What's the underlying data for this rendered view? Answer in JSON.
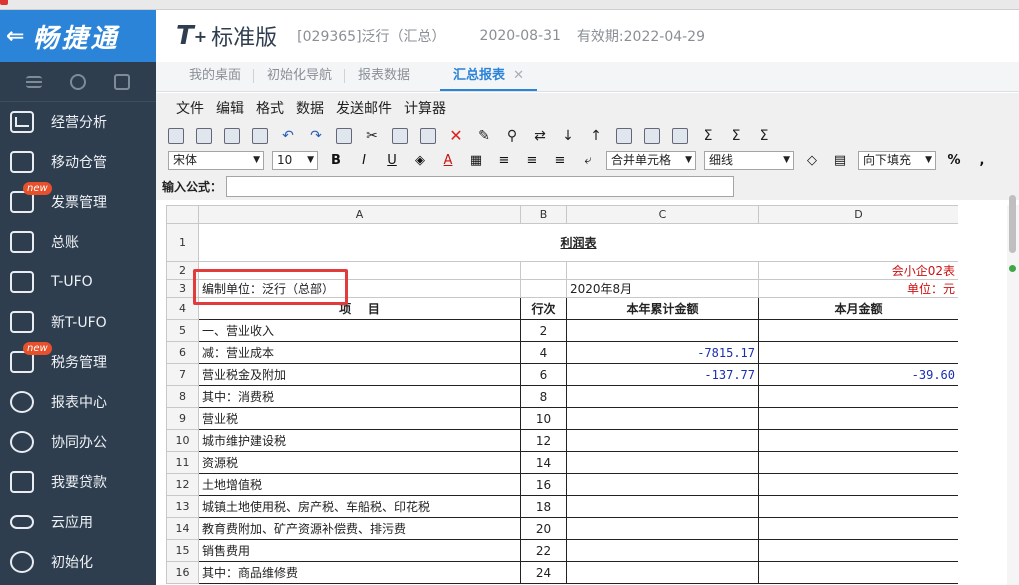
{
  "sidebar": {
    "brand": "畅捷通",
    "items": [
      {
        "label": "经营分析",
        "badge": ""
      },
      {
        "label": "移动仓管",
        "badge": ""
      },
      {
        "label": "发票管理",
        "badge": "new"
      },
      {
        "label": "总账",
        "badge": ""
      },
      {
        "label": "T-UFO",
        "badge": ""
      },
      {
        "label": "新T-UFO",
        "badge": ""
      },
      {
        "label": "税务管理",
        "badge": "new"
      },
      {
        "label": "报表中心",
        "badge": ""
      },
      {
        "label": "协同办公",
        "badge": ""
      },
      {
        "label": "我要贷款",
        "badge": ""
      },
      {
        "label": "云应用",
        "badge": ""
      },
      {
        "label": "初始化",
        "badge": ""
      }
    ]
  },
  "header": {
    "logo_t": "T",
    "logo_plus": "+",
    "edition": "标准版",
    "account": "[029365]泛行（汇总）",
    "date": "2020-08-31",
    "expiry": "有效期:2022-04-29"
  },
  "tabs": [
    {
      "label": "我的桌面"
    },
    {
      "label": "初始化导航"
    },
    {
      "label": "报表数据"
    },
    {
      "label": "汇总报表",
      "close": "✕"
    }
  ],
  "menu": [
    "文件",
    "编辑",
    "格式",
    "数据",
    "发送邮件",
    "计算器"
  ],
  "toolbar": {
    "font": "宋体",
    "size": "10",
    "bold": "B",
    "italic": "I",
    "underline": "U",
    "merge": "合并单元格",
    "border": "细线",
    "fill": "向下填充",
    "percent": "%",
    "comma": ","
  },
  "formula": {
    "label": "输入公式：",
    "value": ""
  },
  "sheet": {
    "columns": [
      "A",
      "B",
      "C",
      "D"
    ],
    "title": "利润表",
    "form_code": "会小企02表",
    "unit_label": "编制单位：泛行（总部）",
    "period": "2020年8月",
    "currency": "单位：元",
    "headers": [
      "项    目",
      "行次",
      "本年累计金额",
      "本月金额"
    ],
    "rows": [
      {
        "num": "5",
        "item": "一、营业收入",
        "line": "2",
        "ytd": "",
        "month": ""
      },
      {
        "num": "6",
        "item": "减：营业成本",
        "line": "4",
        "ytd": "-7815.17",
        "month": ""
      },
      {
        "num": "7",
        "item": "营业税金及附加",
        "line": "6",
        "ytd": "-137.77",
        "month": "-39.60"
      },
      {
        "num": "8",
        "item": "其中：消费税",
        "line": "8",
        "ytd": "",
        "month": ""
      },
      {
        "num": "9",
        "item": "营业税",
        "line": "10",
        "ytd": "",
        "month": ""
      },
      {
        "num": "10",
        "item": "城市维护建设税",
        "line": "12",
        "ytd": "",
        "month": ""
      },
      {
        "num": "11",
        "item": "资源税",
        "line": "14",
        "ytd": "",
        "month": ""
      },
      {
        "num": "12",
        "item": "土地增值税",
        "line": "16",
        "ytd": "",
        "month": ""
      },
      {
        "num": "13",
        "item": "城镇土地使用税、房产税、车船税、印花税",
        "line": "18",
        "ytd": "",
        "month": ""
      },
      {
        "num": "14",
        "item": "教育费附加、矿产资源补偿费、排污费",
        "line": "20",
        "ytd": "",
        "month": ""
      },
      {
        "num": "15",
        "item": "销售费用",
        "line": "22",
        "ytd": "",
        "month": ""
      },
      {
        "num": "16",
        "item": "其中：商品维修费",
        "line": "24",
        "ytd": "",
        "month": ""
      }
    ]
  },
  "colors": {
    "brand": "#2b84d8",
    "sidebar": "#2f3e4f",
    "highlight": "#e23b3b",
    "negative": "#1a2fb0"
  }
}
